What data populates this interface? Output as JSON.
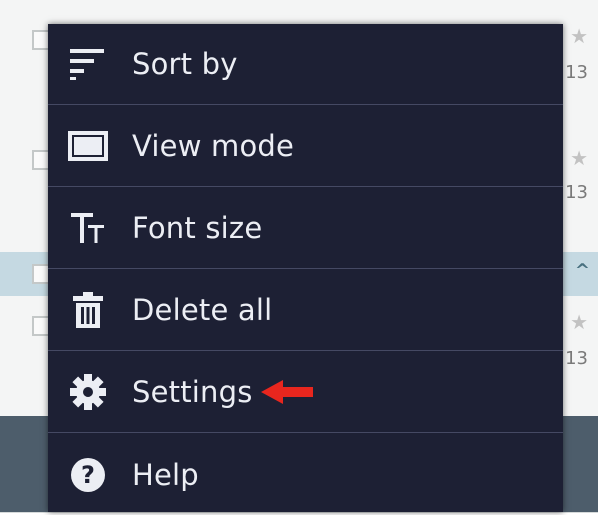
{
  "background_list": {
    "rows": [
      {
        "star": "★",
        "date_fragment": "13"
      },
      {
        "star": "★",
        "date_fragment": "13"
      },
      {
        "star": "★",
        "date_fragment": "13"
      }
    ],
    "collapse_glyph": "^"
  },
  "menu": {
    "items": [
      {
        "label": "Sort by",
        "icon": "sort-lines-icon"
      },
      {
        "label": "View mode",
        "icon": "view-mode-icon"
      },
      {
        "label": "Font size",
        "icon": "font-size-icon"
      },
      {
        "label": "Delete all",
        "icon": "trash-icon"
      },
      {
        "label": "Settings",
        "icon": "gear-icon"
      },
      {
        "label": "Help",
        "icon": "help-icon"
      }
    ]
  },
  "annotation": {
    "icon": "red-arrow-icon",
    "color": "#e8261e"
  },
  "colors": {
    "menu_bg": "#1d2034",
    "divider": "#454963",
    "text": "#eceef4"
  }
}
